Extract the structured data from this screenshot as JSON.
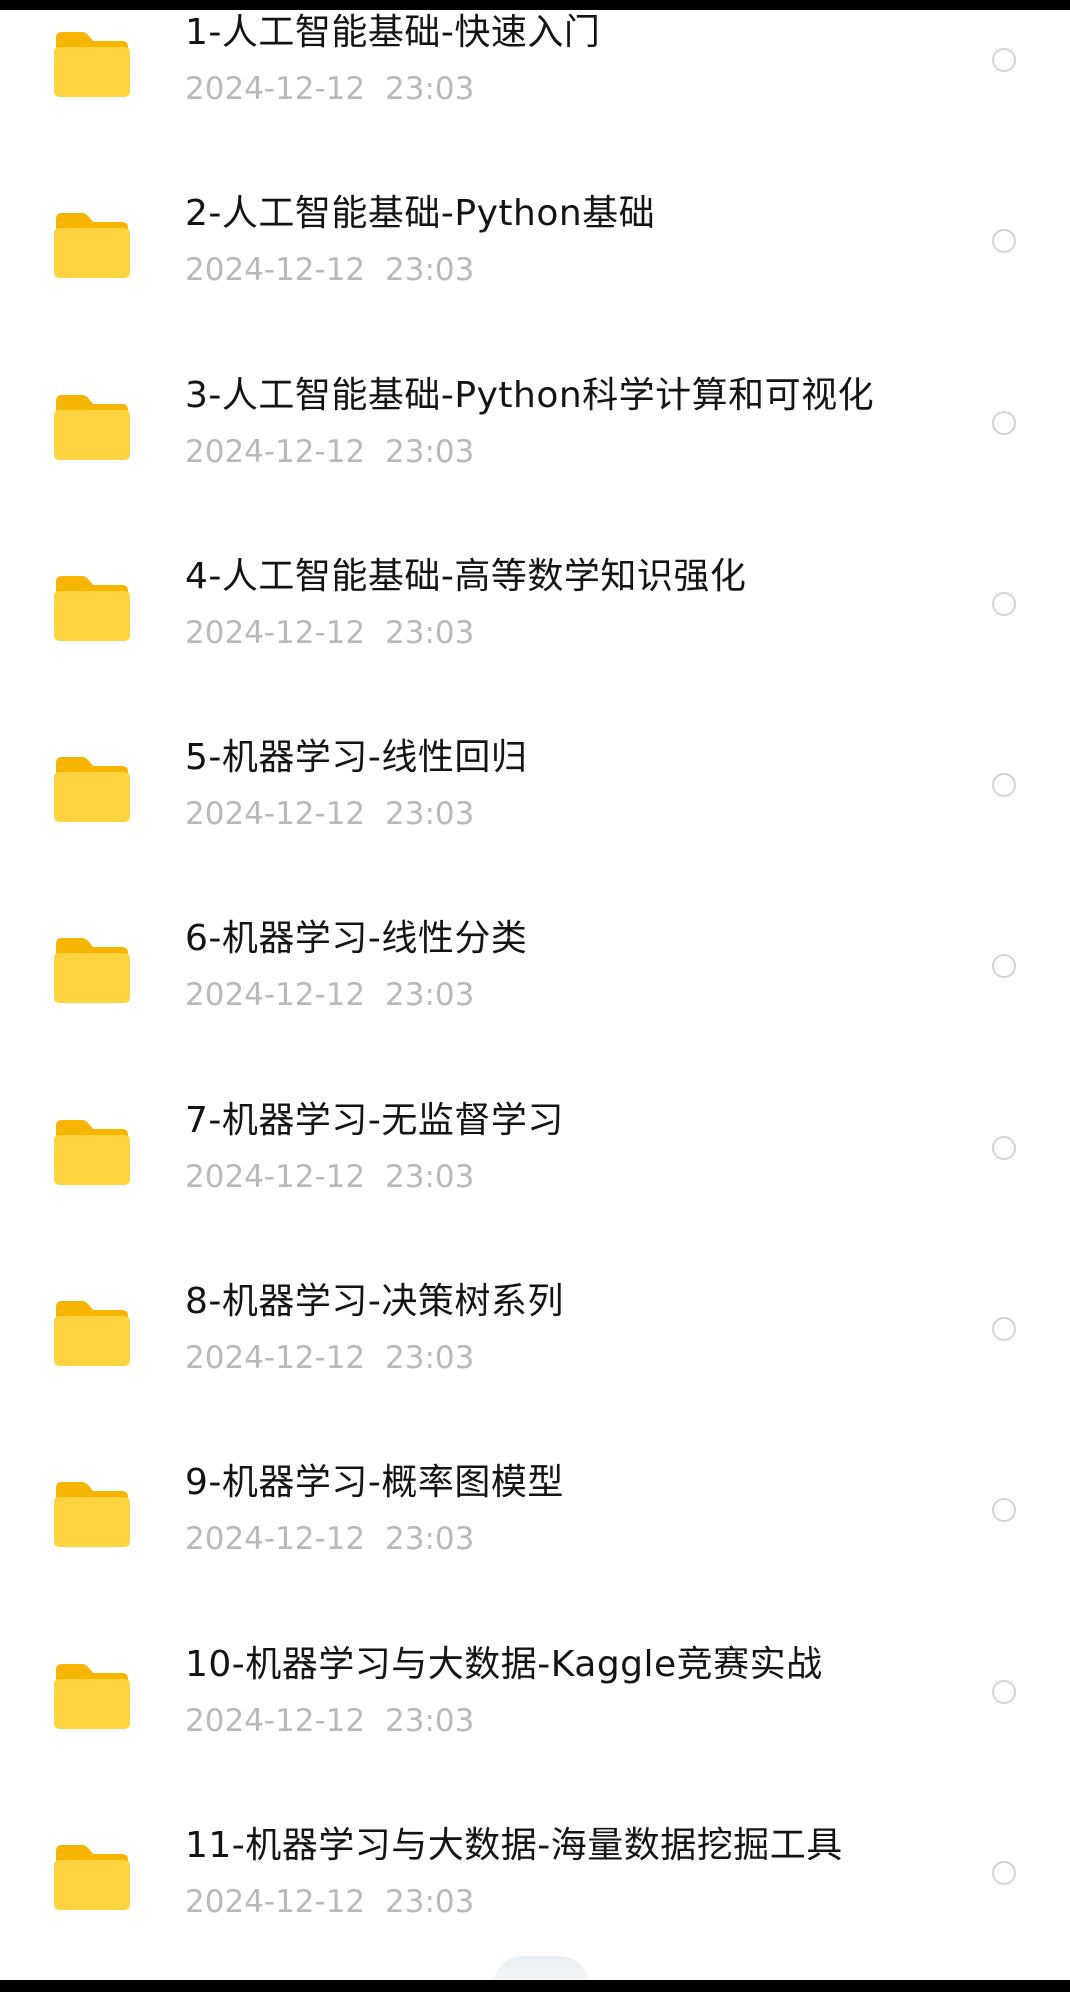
{
  "files": [
    {
      "name": "1-人工智能基础-快速入门",
      "modified": "2024-12-12 23:03"
    },
    {
      "name": "2-人工智能基础-Python基础",
      "modified": "2024-12-12 23:03"
    },
    {
      "name": "3-人工智能基础-Python科学计算和可视化",
      "modified": "2024-12-12 23:03"
    },
    {
      "name": "4-人工智能基础-高等数学知识强化",
      "modified": "2024-12-12 23:03"
    },
    {
      "name": "5-机器学习-线性回归",
      "modified": "2024-12-12 23:03"
    },
    {
      "name": "6-机器学习-线性分类",
      "modified": "2024-12-12 23:03"
    },
    {
      "name": "7-机器学习-无监督学习",
      "modified": "2024-12-12 23:03"
    },
    {
      "name": "8-机器学习-决策树系列",
      "modified": "2024-12-12 23:03"
    },
    {
      "name": "9-机器学习-概率图模型",
      "modified": "2024-12-12 23:03"
    },
    {
      "name": "10-机器学习与大数据-Kaggle竞赛实战",
      "modified": "2024-12-12 23:03"
    },
    {
      "name": "11-机器学习与大数据-海量数据挖掘工具",
      "modified": "2024-12-12 23:03"
    }
  ],
  "icons": {
    "folder": "folder-icon",
    "select": "radio-unchecked-icon"
  },
  "colors": {
    "folder_front": "#FFD23F",
    "folder_back": "#F6B500",
    "name_text": "#141414",
    "time_text": "#B9B9B9",
    "radio_border": "#D3D3D3"
  }
}
